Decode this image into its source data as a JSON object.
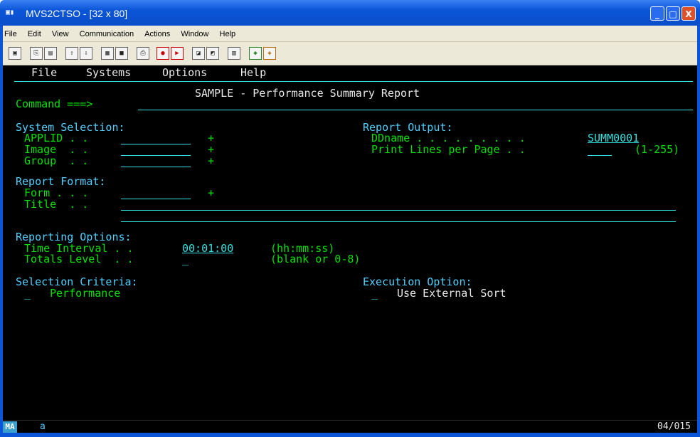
{
  "window": {
    "title": "MVS2CTSO - [32 x 80]",
    "app_icon": "terminal-icon",
    "buttons": {
      "minimize": "_",
      "maximize": "□",
      "close": "X"
    }
  },
  "menubar": [
    "File",
    "Edit",
    "View",
    "Communication",
    "Actions",
    "Window",
    "Help"
  ],
  "toolbar": {
    "icons": [
      "frame-icon",
      "copy-icon",
      "paste-icon",
      "send-icon",
      "receive-icon",
      "display-icon",
      "screen-icon",
      "print-icon",
      "record-icon",
      "playback-icon",
      "macro-icon",
      "macro-stop-icon",
      "clipboard-icon",
      "connect-icon",
      "disconnect-icon"
    ]
  },
  "terminal": {
    "menu": [
      "File",
      "Systems",
      "Options",
      "Help"
    ],
    "title": "SAMPLE - Performance Summary Report",
    "command_label": "Command ===>",
    "system_selection": {
      "heading": "System Selection:",
      "applid": "APPLID . .",
      "image": "Image  . .",
      "group": "Group  . .",
      "plus": "+"
    },
    "report_output": {
      "heading": "Report Output:",
      "ddname_label": "DDname . . . . . . . . .",
      "ddname_value": "SUMM0001",
      "print_lines_label": "Print Lines per Page . .",
      "print_lines_range": "(1-255)"
    },
    "report_format": {
      "heading": "Report Format:",
      "form": "Form . . .",
      "title": "Title  . .",
      "plus": "+"
    },
    "reporting_options": {
      "heading": "Reporting Options:",
      "time_interval_label": "Time Interval . .",
      "time_interval_value": "00:01:00",
      "time_interval_hint": "(hh:mm:ss)",
      "totals_level_label": "Totals Level  . .",
      "totals_level_value": "_",
      "totals_level_hint": "(blank or 0-8)"
    },
    "selection_criteria": {
      "heading": "Selection Criteria:",
      "marker": "_",
      "item": "Performance"
    },
    "execution_option": {
      "heading": "Execution Option:",
      "marker": "_",
      "item": "Use External Sort"
    }
  },
  "statusbar": {
    "mode": "MA",
    "session": "a",
    "cursor_pos": "04/015"
  }
}
